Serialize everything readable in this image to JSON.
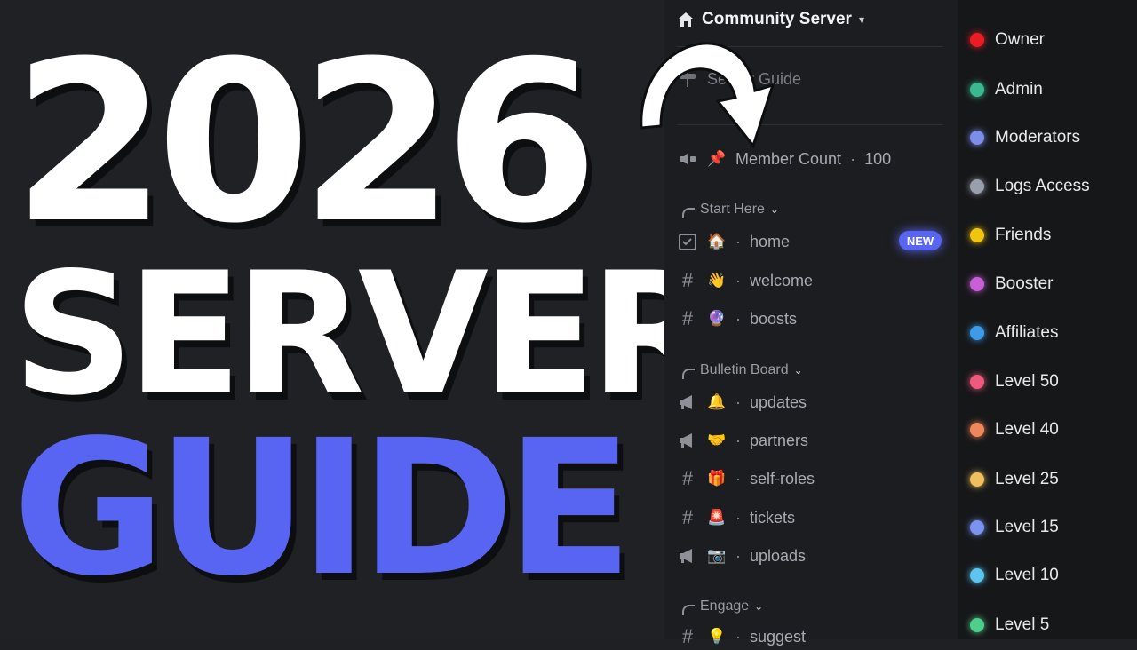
{
  "title": {
    "line1": "2026",
    "line2": "SERVER",
    "line3": "GUIDE"
  },
  "server": {
    "name": "Community Server",
    "header_icon": "home-icon"
  },
  "guide_label": "Server Guide",
  "member_count": {
    "emoji": "📌",
    "label": "Member Count",
    "value": "100"
  },
  "categories": [
    {
      "name": "Start Here",
      "channels": [
        {
          "icon": "checklist-icon",
          "emoji": "🏠",
          "name": "home",
          "badge": "NEW"
        },
        {
          "icon": "hash-icon",
          "emoji": "👋",
          "name": "welcome"
        },
        {
          "icon": "hash-icon",
          "emoji": "🔮",
          "name": "boosts"
        }
      ]
    },
    {
      "name": "Bulletin Board",
      "channels": [
        {
          "icon": "megaphone-icon",
          "emoji": "🔔",
          "name": "updates"
        },
        {
          "icon": "megaphone-icon",
          "emoji": "🤝",
          "name": "partners"
        },
        {
          "icon": "hash-icon",
          "emoji": "🎁",
          "name": "self-roles"
        },
        {
          "icon": "hash-icon",
          "emoji": "🚨",
          "name": "tickets"
        },
        {
          "icon": "megaphone-icon",
          "emoji": "📷",
          "name": "uploads"
        }
      ]
    },
    {
      "name": "Engage",
      "channels": [
        {
          "icon": "hash-icon",
          "emoji": "💡",
          "name": "suggest"
        }
      ]
    }
  ],
  "roles": [
    {
      "name": "Owner",
      "color": "#ed1c24"
    },
    {
      "name": "Admin",
      "color": "#3ab88f"
    },
    {
      "name": "Moderators",
      "color": "#7d8ee8"
    },
    {
      "name": "Logs Access",
      "color": "#9aa0ab"
    },
    {
      "name": "Friends",
      "color": "#f1c40f"
    },
    {
      "name": "Booster",
      "color": "#c85fd6"
    },
    {
      "name": "Affiliates",
      "color": "#3d9be9"
    },
    {
      "name": "Level 50",
      "color": "#ee5a7d"
    },
    {
      "name": "Level 40",
      "color": "#f0875a"
    },
    {
      "name": "Level 25",
      "color": "#eec15c"
    },
    {
      "name": "Level 15",
      "color": "#7a94f0"
    },
    {
      "name": "Level 10",
      "color": "#5cc5ef"
    },
    {
      "name": "Level 5",
      "color": "#4fcf8a"
    }
  ],
  "colors": {
    "accent": "#5865f2"
  }
}
